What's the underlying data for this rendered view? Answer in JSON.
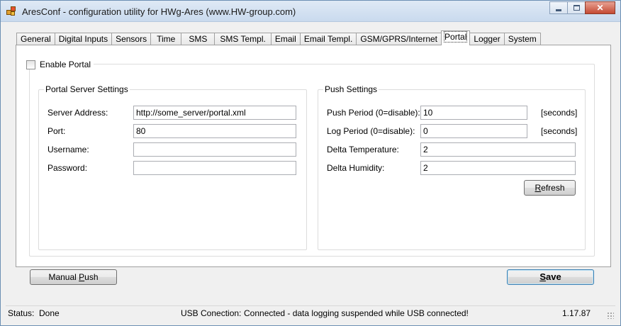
{
  "window": {
    "title": "AresConf - configuration utility for HWg-Ares (www.HW-group.com)",
    "close_glyph": "✕"
  },
  "tabs": [
    {
      "label": "General"
    },
    {
      "label": "Digital Inputs"
    },
    {
      "label": "Sensors"
    },
    {
      "label": "Time"
    },
    {
      "label": "SMS"
    },
    {
      "label": "SMS Templ."
    },
    {
      "label": "Email"
    },
    {
      "label": "Email Templ."
    },
    {
      "label": "GSM/GPRS/Internet"
    },
    {
      "label": "Portal",
      "active": true
    },
    {
      "label": "Logger"
    },
    {
      "label": "System"
    }
  ],
  "portal": {
    "enable_label": "Enable Portal",
    "enabled": false,
    "server_settings": {
      "title": "Portal Server Settings",
      "server_address_label": "Server Address:",
      "server_address_value": "http://some_server/portal.xml",
      "port_label": "Port:",
      "port_value": "80",
      "username_label": "Username:",
      "username_value": "",
      "password_label": "Password:",
      "password_value": ""
    },
    "push_settings": {
      "title": "Push Settings",
      "push_period_label": "Push Period (0=disable):",
      "push_period_value": "10",
      "push_period_unit": "[seconds]",
      "log_period_label": "Log Period (0=disable):",
      "log_period_value": "0",
      "log_period_unit": "[seconds]",
      "delta_temp_label": "Delta Temperature:",
      "delta_temp_value": "2",
      "delta_humidity_label": "Delta Humidity:",
      "delta_humidity_value": "2",
      "refresh_prefix": "R",
      "refresh_rest": "efresh"
    }
  },
  "buttons": {
    "manual_push_prefix": "Manual ",
    "manual_push_accel": "P",
    "manual_push_rest": "ush",
    "save_accel": "S",
    "save_rest": "ave"
  },
  "status": {
    "status_label": "Status:",
    "status_value": "Done",
    "usb_label": "USB Conection:",
    "usb_value": "Connected - data logging suspended while USB connected!",
    "version": "1.17.87"
  }
}
